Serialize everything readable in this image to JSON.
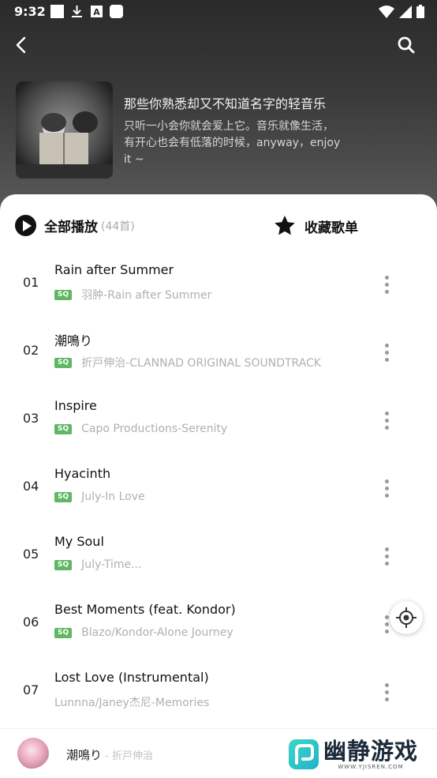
{
  "status_bar": {
    "time": "9:32"
  },
  "header": {
    "album_title": "那些你熟悉却又不知道名字的轻音乐",
    "album_description": "只听一小会你就会爱上它。音乐就像生活，有开心也会有低落的时候，anyway，enjoy it ~"
  },
  "actions": {
    "play_all_label": "全部播放",
    "play_all_count": "(44首)",
    "collect_label": "收藏歌单"
  },
  "tracks": [
    {
      "num": "01",
      "title": "Rain after Summer",
      "sq": "SQ",
      "subtitle": "羽肿-Rain after Summer"
    },
    {
      "num": "02",
      "title": "潮鳴り",
      "sq": "SQ",
      "subtitle": "折戸伸治-CLANNAD ORIGINAL SOUNDTRACK"
    },
    {
      "num": "03",
      "title": "Inspire",
      "sq": "SQ",
      "subtitle": "Capo Productions-Serenity"
    },
    {
      "num": "04",
      "title": "Hyacinth",
      "sq": "SQ",
      "subtitle": "July-In Love"
    },
    {
      "num": "05",
      "title": "My Soul",
      "sq": "SQ",
      "subtitle": "July-Time..."
    },
    {
      "num": "06",
      "title": "Best Moments (feat. Kondor)",
      "sq": "SQ",
      "subtitle": "Blazo/Kondor-Alone Journey"
    },
    {
      "num": "07",
      "title": "Lost Love (Instrumental)",
      "sq": "",
      "subtitle": "Lunnna/Janey杰尼-Memories"
    }
  ],
  "mini_player": {
    "title": "潮鳴り",
    "artist": " - 折戸伸治"
  },
  "watermark": {
    "text": "幽静游戏",
    "url": "WWW.YJISREN.COM"
  },
  "colors": {
    "sq_badge": "#5fb663",
    "header_dark": "#2a2a2a"
  },
  "icons": {
    "back": "chevron-left-icon",
    "search": "search-icon",
    "play": "play-circle-icon",
    "collect": "star-icon",
    "more": "more-vertical-icon",
    "locate": "locate-icon"
  }
}
